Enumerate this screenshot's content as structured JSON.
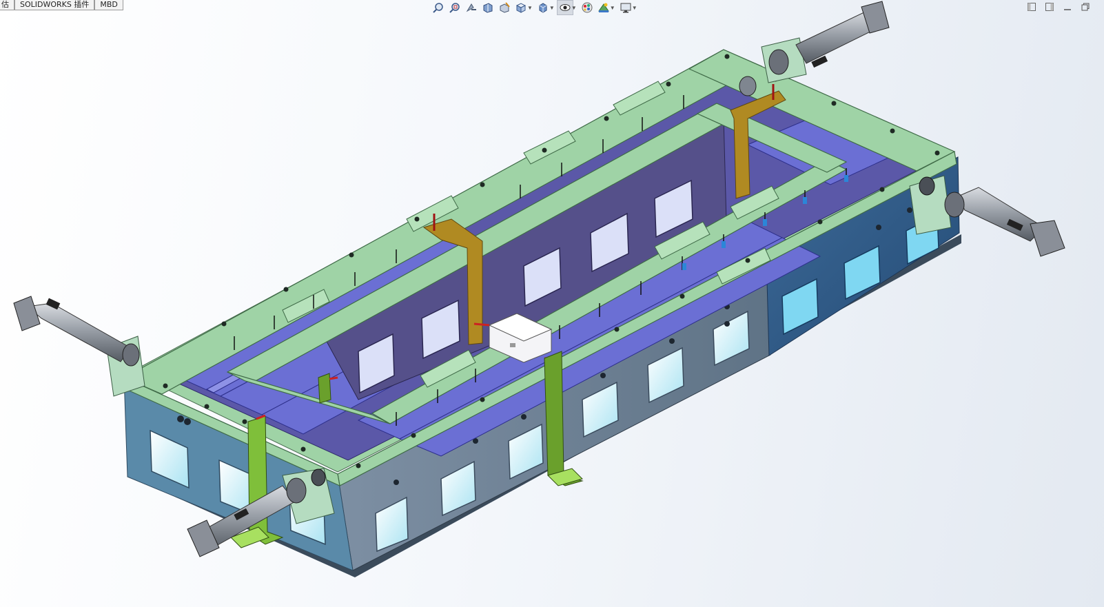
{
  "tabs": [
    {
      "label": "估",
      "icon": null
    },
    {
      "label": "SOLIDWORKS 插件",
      "icon": null
    },
    {
      "label": "MBD",
      "icon": null
    }
  ],
  "heads_up_toolbar": [
    {
      "icon": "zoom-to-fit-icon"
    },
    {
      "icon": "zoom-to-area-icon"
    },
    {
      "icon": "previous-view-icon"
    },
    {
      "icon": "section-view-icon"
    },
    {
      "icon": "dynamic-annotation-view-icon"
    },
    {
      "icon": "view-orientation-icon",
      "dropdown": true
    },
    {
      "icon": "display-style-icon",
      "dropdown": true
    },
    {
      "icon": "hide-show-items-icon",
      "dropdown": true,
      "active": true
    },
    {
      "icon": "edit-appearance-icon"
    },
    {
      "icon": "apply-scene-icon",
      "dropdown": true
    },
    {
      "icon": "view-settings-icon",
      "dropdown": true
    }
  ],
  "window_controls": [
    {
      "icon": "tile-left-icon"
    },
    {
      "icon": "tile-right-icon"
    },
    {
      "icon": "minimize-icon"
    },
    {
      "icon": "restore-icon"
    }
  ],
  "model": {
    "description_visible": false,
    "colors": {
      "frame_top": "#9fd3a6",
      "wall_side": "#6a7f92",
      "wall_end": "#2f5d8c",
      "inner_plate": "#6b6fd4",
      "divider": "#55508a",
      "brass_bracket": "#b08a22",
      "green_bracket": "#7fbf3a",
      "cylinder": "#8a8f98",
      "load_cell": "#f4f4f7"
    }
  }
}
